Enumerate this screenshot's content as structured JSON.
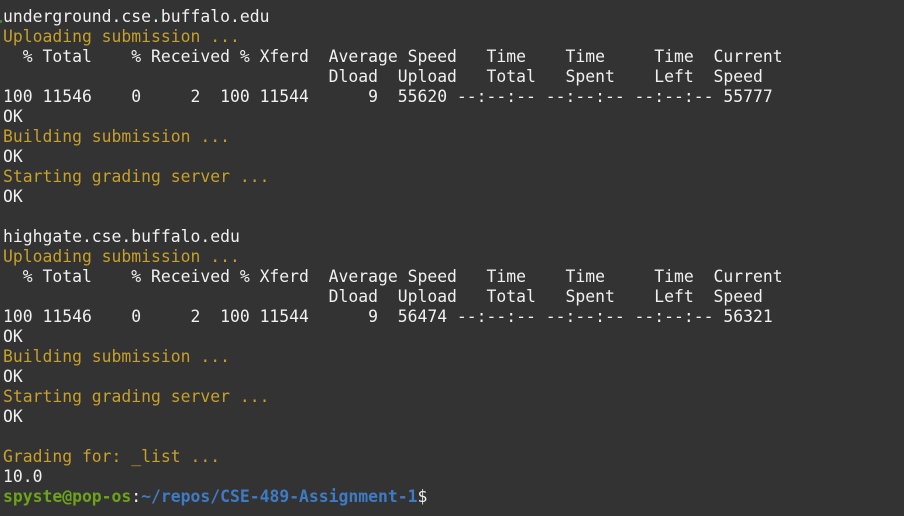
{
  "terminal": {
    "lines": [
      {
        "text": "underground.cse.buffalo.edu",
        "style": "white"
      },
      {
        "text": "Uploading submission ...",
        "style": "yellow"
      },
      {
        "text": "  % Total    % Received % Xferd  Average Speed   Time    Time     Time  Current",
        "style": "white"
      },
      {
        "text": "                                 Dload  Upload   Total   Spent    Left  Speed",
        "style": "white"
      },
      {
        "text": "100 11546    0     2  100 11544      9  55620 --:--:-- --:--:-- --:--:-- 55777",
        "style": "white"
      },
      {
        "text": "OK",
        "style": "white"
      },
      {
        "text": "Building submission ...",
        "style": "yellow"
      },
      {
        "text": "OK",
        "style": "white"
      },
      {
        "text": "Starting grading server ...",
        "style": "yellow"
      },
      {
        "text": "OK",
        "style": "white"
      },
      {
        "text": "",
        "style": "white"
      },
      {
        "text": "highgate.cse.buffalo.edu",
        "style": "white"
      },
      {
        "text": "Uploading submission ...",
        "style": "yellow"
      },
      {
        "text": "  % Total    % Received % Xferd  Average Speed   Time    Time     Time  Current",
        "style": "white"
      },
      {
        "text": "                                 Dload  Upload   Total   Spent    Left  Speed",
        "style": "white"
      },
      {
        "text": "100 11546    0     2  100 11544      9  56474 --:--:-- --:--:-- --:--:-- 56321",
        "style": "white"
      },
      {
        "text": "OK",
        "style": "white"
      },
      {
        "text": "Building submission ...",
        "style": "yellow"
      },
      {
        "text": "OK",
        "style": "white"
      },
      {
        "text": "Starting grading server ...",
        "style": "yellow"
      },
      {
        "text": "OK",
        "style": "white"
      },
      {
        "text": "",
        "style": "white"
      },
      {
        "text": "Grading for: _list ...",
        "style": "yellow"
      },
      {
        "text": "10.0",
        "style": "white"
      }
    ],
    "prompt": {
      "user_host": "spyste@pop-os",
      "separator": ":",
      "path": "~/repos/CSE-489-Assignment-1",
      "symbol": "$"
    }
  },
  "colors": {
    "background": "#333333",
    "status_yellow": "#c7a02a",
    "prompt_green": "#6da31a",
    "path_blue": "#3f7bc4"
  }
}
